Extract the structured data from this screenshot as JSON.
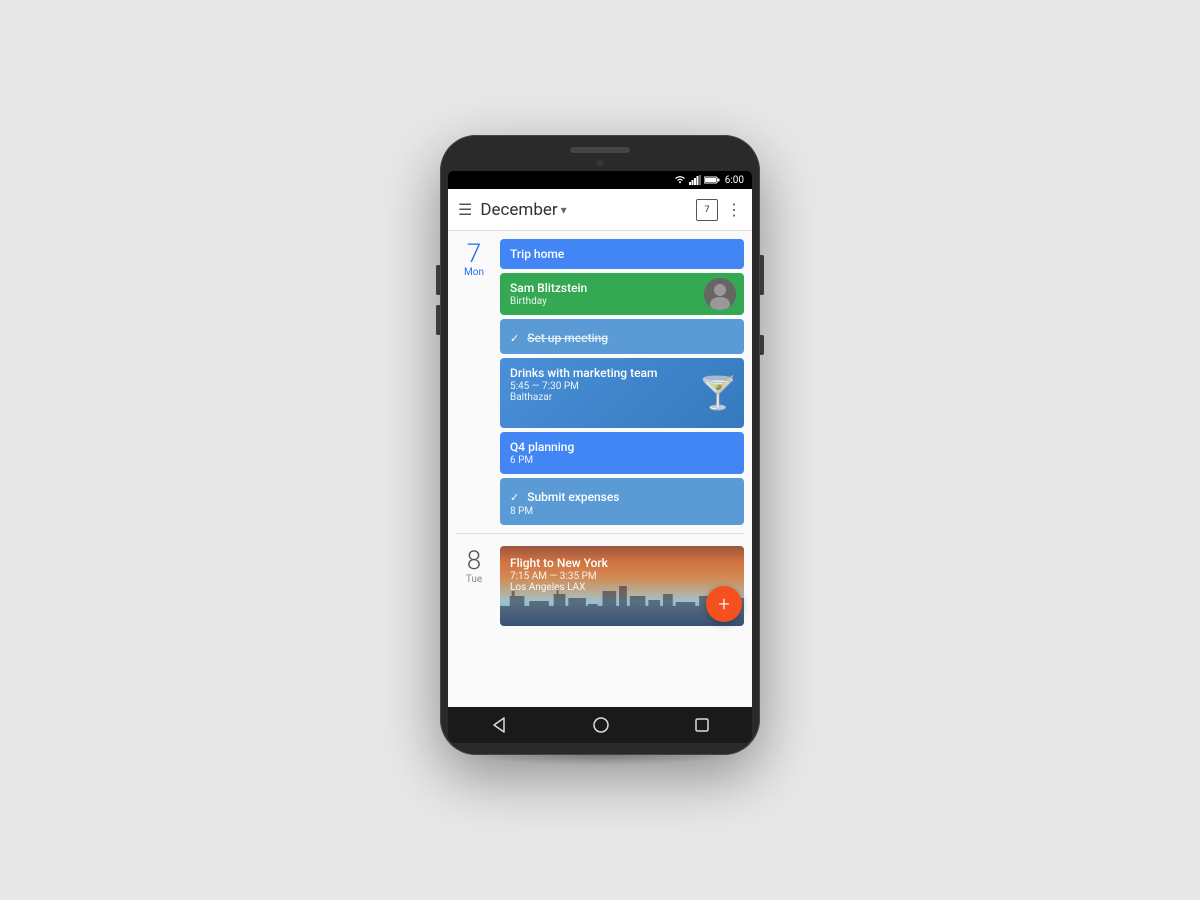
{
  "statusBar": {
    "time": "6:00"
  },
  "header": {
    "menuLabel": "☰",
    "title": "December",
    "dropdownIcon": "▾",
    "calendarDay": "7",
    "moreIcon": "⋮"
  },
  "days": [
    {
      "id": "day-7",
      "number": "7",
      "name": "Mon",
      "events": [
        {
          "id": "evt-trip",
          "type": "regular",
          "colorClass": "blue",
          "title": "Trip home",
          "subtitle": "",
          "location": "",
          "isTask": false,
          "strikethrough": false
        },
        {
          "id": "evt-bday",
          "type": "birthday",
          "colorClass": "green",
          "title": "Sam Blitzstein",
          "subtitle": "Birthday",
          "location": "",
          "isTask": false,
          "strikethrough": false,
          "hasAvatar": true
        },
        {
          "id": "evt-meeting",
          "type": "task",
          "colorClass": "light-blue",
          "title": "Set up meeting",
          "subtitle": "",
          "location": "",
          "isTask": true,
          "strikethrough": true
        },
        {
          "id": "evt-drinks",
          "type": "drinks",
          "colorClass": "teal-blue",
          "title": "Drinks with marketing team",
          "subtitle": "5:45 — 7:30 PM",
          "location": "Balthazar",
          "isTask": false,
          "strikethrough": false,
          "hasCocktail": true
        },
        {
          "id": "evt-q4",
          "type": "regular",
          "colorClass": "blue",
          "title": "Q4 planning",
          "subtitle": "6 PM",
          "location": "",
          "isTask": false,
          "strikethrough": false
        },
        {
          "id": "evt-expenses",
          "type": "task",
          "colorClass": "light-blue",
          "title": "Submit expenses",
          "subtitle": "8 PM",
          "location": "",
          "isTask": true,
          "strikethrough": false
        }
      ]
    },
    {
      "id": "day-8",
      "number": "8",
      "name": "Tue",
      "events": [
        {
          "id": "evt-flight",
          "type": "flight",
          "colorClass": "flight",
          "title": "Flight to New York",
          "subtitle": "7:15 AM — 3:35 PM",
          "location": "Los Angeles LAX",
          "isTask": false,
          "strikethrough": false
        }
      ]
    }
  ],
  "navBar": {
    "backIcon": "◁",
    "homeIcon": "○",
    "recentIcon": "□"
  },
  "fab": {
    "label": "+"
  }
}
